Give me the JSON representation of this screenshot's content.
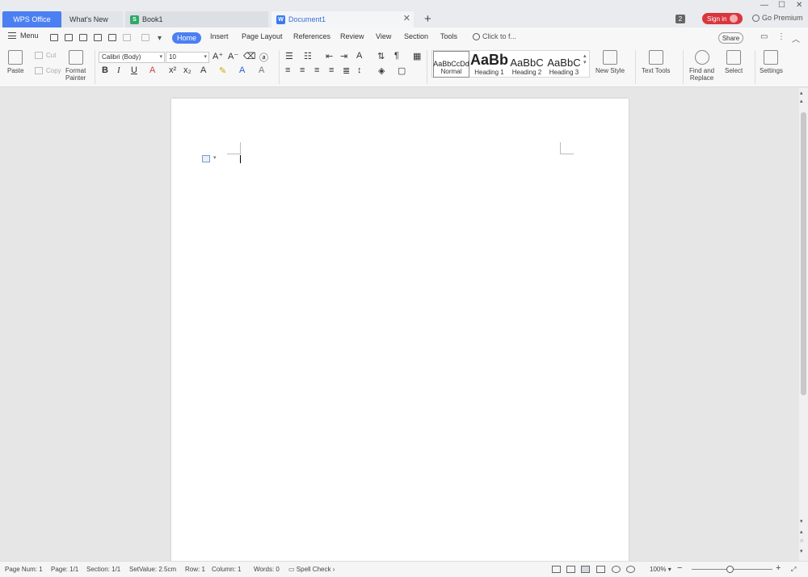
{
  "tabs": {
    "wps_office": "WPS Office",
    "whats_new": "What's New",
    "book": "Book1",
    "document": "Document1",
    "book_icon_letter": "S",
    "doc_icon_letter": "W"
  },
  "titlebar": {
    "badge_count": "2",
    "sign_in": "Sign in",
    "go_premium": "Go Premium"
  },
  "menubar": {
    "menu_label": "Menu",
    "tabs": [
      "Home",
      "Insert",
      "Page Layout",
      "References",
      "Review",
      "View",
      "Section",
      "Tools"
    ],
    "search_placeholder": "Click to f...",
    "share": "Share"
  },
  "ribbon": {
    "paste": "Paste",
    "cut": "Cut",
    "copy": "Copy",
    "format_painter_1": "Format",
    "format_painter_2": "Painter",
    "font_name": "Calibri (Body)",
    "font_size": "10",
    "styles": [
      {
        "preview": "AaBbCcDd",
        "label": "Normal"
      },
      {
        "preview": "AaBb",
        "label": "Heading 1"
      },
      {
        "preview": "AaBbC",
        "label": "Heading 2"
      },
      {
        "preview": "AaBbC",
        "label": "Heading 3"
      }
    ],
    "new_style": "New Style",
    "text_tools": "Text Tools",
    "find_replace_1": "Find and",
    "find_replace_2": "Replace",
    "select": "Select",
    "settings": "Settings"
  },
  "statusbar": {
    "page_num": "Page Num: 1",
    "page": "Page: 1/1",
    "section": "Section: 1/1",
    "set_value": "SetValue: 2.5cm",
    "row": "Row: 1",
    "column": "Column: 1",
    "words": "Words: 0",
    "spell_check": "Spell Check",
    "zoom": "100%"
  },
  "colors": {
    "accent": "#4b7ff2",
    "sign_in": "#d9363e"
  }
}
